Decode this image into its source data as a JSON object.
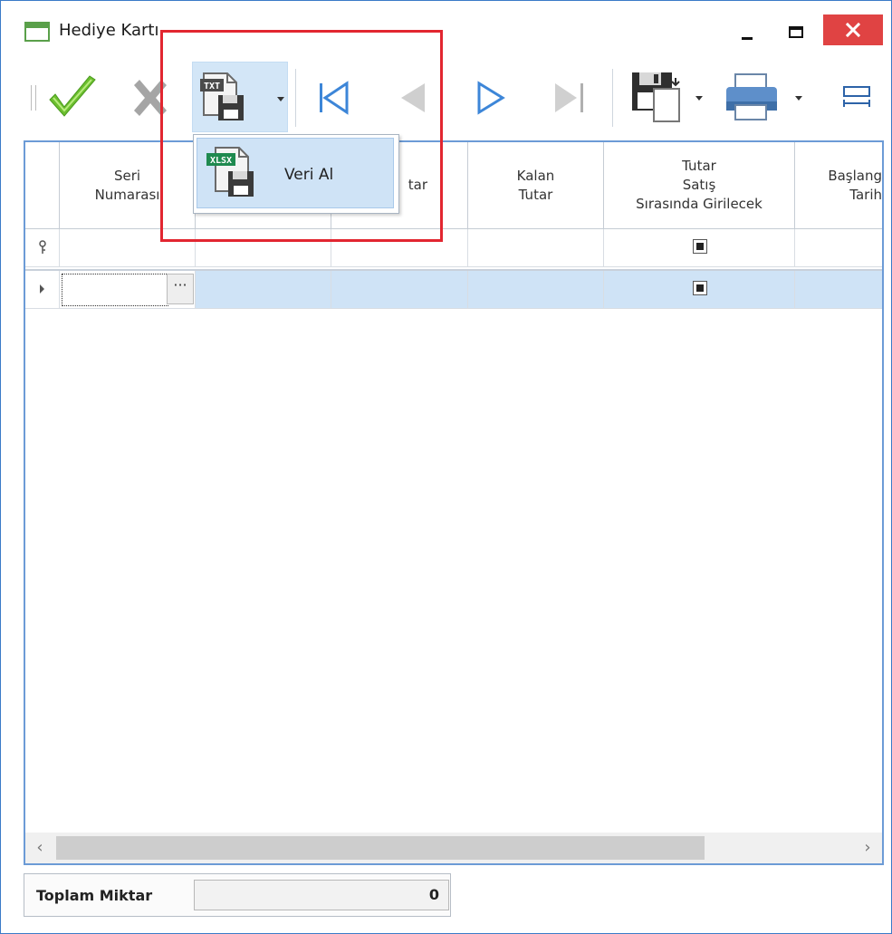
{
  "window": {
    "title": "Hediye Kartı",
    "controls": {
      "minimize": "minimize",
      "maximize": "maximize",
      "close": "close"
    }
  },
  "toolbar": {
    "buttons": [
      {
        "name": "accept",
        "icon": "checkmark-icon",
        "color": "#6cbf2f"
      },
      {
        "name": "cancel",
        "icon": "x-icon",
        "color": "#9a9a9a"
      },
      {
        "name": "import",
        "icon": "txt-file-save-icon",
        "badge": "TXT"
      },
      {
        "name": "first",
        "icon": "first-record-icon"
      },
      {
        "name": "previous",
        "icon": "previous-record-icon"
      },
      {
        "name": "next",
        "icon": "next-record-icon"
      },
      {
        "name": "last",
        "icon": "last-record-icon"
      },
      {
        "name": "save",
        "icon": "floppy-save-icon"
      },
      {
        "name": "print",
        "icon": "printer-icon"
      },
      {
        "name": "fit-columns",
        "icon": "column-fit-icon"
      }
    ]
  },
  "dropdown": {
    "items": [
      {
        "label": "Veri Al",
        "icon": "xlsx-file-save-icon",
        "badge": "XLSX"
      }
    ]
  },
  "grid": {
    "columns": [
      {
        "lines": [
          "Seri",
          "Numarası"
        ]
      },
      {
        "lines": [
          ""
        ]
      },
      {
        "lines": [
          "tar"
        ]
      },
      {
        "lines": [
          "Kalan",
          "Tutar"
        ]
      },
      {
        "lines": [
          "Tutar",
          "Satış",
          "Sırasında Girilecek"
        ]
      },
      {
        "lines": [
          "Başlang",
          "Tarih"
        ]
      }
    ],
    "filter_row_icon": "filter-key-icon",
    "current_row_icon": "row-pointer-icon",
    "ellipsis_button": "···"
  },
  "footer": {
    "label": "Toplam Miktar",
    "value": "0"
  },
  "colors": {
    "accent": "#6c9bd6",
    "selected_row": "#cfe3f6",
    "close_button": "#e04343",
    "highlight_box": "#e22630"
  }
}
